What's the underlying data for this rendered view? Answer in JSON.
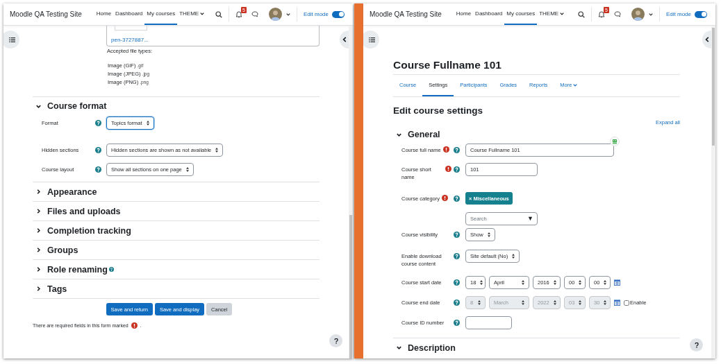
{
  "left_window": {
    "navbar": {
      "site_name": "Moodle QA Testing Site",
      "links": [
        {
          "label": "Home",
          "selected": false,
          "caret": false
        },
        {
          "label": "Dashboard",
          "selected": false,
          "caret": false
        },
        {
          "label": "My courses",
          "selected": true,
          "caret": false
        },
        {
          "label": "THEME",
          "selected": false,
          "caret": true
        }
      ],
      "notifications": "5",
      "edit_mode": {
        "label": "Edit mode",
        "on": true
      }
    },
    "file_link": "pen-3727887...",
    "accepted_label": "Accepted file types:",
    "file_types": [
      {
        "name": "Image (GIF)",
        "ext": ".gif"
      },
      {
        "name": "Image (JPEG)",
        "ext": ".jpg"
      },
      {
        "name": "Image (PNG)",
        "ext": ".png"
      }
    ],
    "sections": [
      {
        "title": "Course format",
        "expanded": true,
        "help": false,
        "fields": [
          {
            "label": "Format",
            "value": "Topics format",
            "focused": true
          },
          {
            "label": "Hidden sections",
            "value": "Hidden sections are shown as not available",
            "focused": false
          },
          {
            "label": "Course layout",
            "value": "Show all sections on one page",
            "focused": false
          }
        ]
      },
      {
        "title": "Appearance",
        "expanded": false,
        "help": false
      },
      {
        "title": "Files and uploads",
        "expanded": false,
        "help": false
      },
      {
        "title": "Completion tracking",
        "expanded": false,
        "help": false
      },
      {
        "title": "Groups",
        "expanded": false,
        "help": false
      },
      {
        "title": "Role renaming",
        "expanded": false,
        "help": true
      },
      {
        "title": "Tags",
        "expanded": false,
        "help": false
      }
    ],
    "buttons": [
      {
        "label": "Save and return",
        "kind": "primary"
      },
      {
        "label": "Save and display",
        "kind": "primary"
      },
      {
        "label": "Cancel",
        "kind": "secondary"
      }
    ],
    "required_note": "There are required fields in this form marked",
    "required_note_end": "."
  },
  "right_window": {
    "navbar": {
      "site_name": "Moodle QA Testing Site",
      "links": [
        {
          "label": "Home",
          "selected": false,
          "caret": false
        },
        {
          "label": "Dashboard",
          "selected": false,
          "caret": false
        },
        {
          "label": "My courses",
          "selected": true,
          "caret": false
        },
        {
          "label": "THEME",
          "selected": false,
          "caret": true
        }
      ],
      "notifications": "5",
      "edit_mode": {
        "label": "Edit mode",
        "on": true
      }
    },
    "course_title": "Course Fullname 101",
    "tabs": [
      {
        "label": "Course",
        "selected": false,
        "caret": false
      },
      {
        "label": "Settings",
        "selected": true,
        "caret": false
      },
      {
        "label": "Participants",
        "selected": false,
        "caret": false
      },
      {
        "label": "Grades",
        "selected": false,
        "caret": false
      },
      {
        "label": "Reports",
        "selected": false,
        "caret": false
      },
      {
        "label": "More",
        "selected": false,
        "caret": true
      }
    ],
    "heading": "Edit course settings",
    "expand_all": "Expand all",
    "sections": [
      {
        "title": "General",
        "expanded": true,
        "fields": [
          {
            "kind": "text",
            "label": "Course full name",
            "required": true,
            "value": "Course Fullname 101",
            "badge": true
          },
          {
            "kind": "text",
            "label": "Course short name",
            "required": true,
            "value": "101",
            "badge": false
          },
          {
            "kind": "tags",
            "label": "Course category",
            "required": true,
            "tag": "× Miscellaneous",
            "placeholder": "Search",
            "arrow": "▼"
          },
          {
            "kind": "select",
            "label": "Course visibility",
            "required": false,
            "value": "Show"
          },
          {
            "kind": "select",
            "label": "Enable download course content",
            "required": false,
            "value": "Site default (No)"
          },
          {
            "kind": "date",
            "label": "Course start date",
            "required": false,
            "disabled": false,
            "parts": [
              "18",
              "April",
              "2016",
              "00",
              "00"
            ]
          },
          {
            "kind": "date",
            "label": "Course end date",
            "required": false,
            "disabled": true,
            "parts": [
              "8",
              "March",
              "2022",
              "03",
              "30"
            ],
            "enable": {
              "label": "Enable",
              "checked": false
            }
          },
          {
            "kind": "text",
            "label": "Course ID number",
            "required": false,
            "badge": false
          }
        ]
      },
      {
        "title": "Description",
        "expanded": true
      }
    ]
  }
}
